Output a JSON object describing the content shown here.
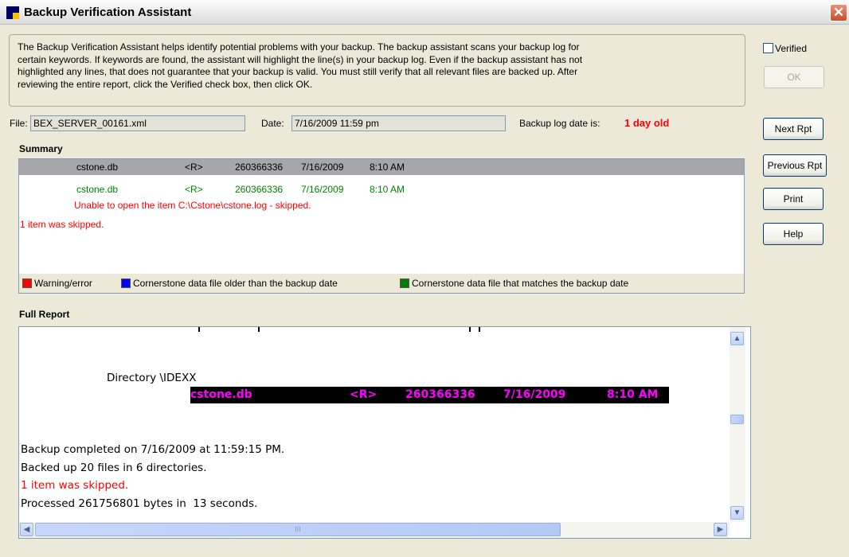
{
  "window": {
    "title": "Backup Verification Assistant",
    "close_glyph": "✕"
  },
  "intro_lines": [
    "The Backup Verification Assistant helps identify potential problems with your backup. The backup assistant scans your backup log for",
    "certain keywords. If keywords are found, the assistant will highlight the line(s) in your backup log. Even if the backup assistant has not",
    "highlighted any lines, that does not guarantee that your backup is valid. You must still verify that all relevant files are backed up. After",
    "reviewing the entire report, click the Verified check box, then click OK."
  ],
  "verified": {
    "label": "Verified",
    "checked": false
  },
  "buttons": {
    "ok": "OK",
    "next": "Next Rpt",
    "previous": "Previous Rpt",
    "print": "Print",
    "help": "Help"
  },
  "file": {
    "label": "File:",
    "value": "BEX_SERVER_00161.xml"
  },
  "date": {
    "label": "Date:",
    "value": "7/16/2009 11:59 pm"
  },
  "log_age": {
    "label": "Backup log date is:",
    "value": "1 day old"
  },
  "summary": {
    "heading": "Summary",
    "rows": [
      {
        "name": "cstone.db",
        "attr": "<R>",
        "size": "260366336",
        "date": "7/16/2009",
        "time": "8:10 AM"
      },
      {
        "name": "cstone.db",
        "attr": "<R>",
        "size": "260366336",
        "date": "7/16/2009",
        "time": "8:10 AM"
      }
    ],
    "error_line": "Unable to open the item C:\\Cstone\\cstone.log - skipped.",
    "skipped_line": "1 item was skipped."
  },
  "legend": {
    "warning": "Warning/error",
    "older": "Cornerstone data file older than the backup date",
    "matches": "Cornerstone data file that matches the backup date"
  },
  "colors": {
    "warning": "#ff0000",
    "older": "#0000ff",
    "matches": "#008000",
    "highlight_text": "#ff00ff"
  },
  "full_report": {
    "heading": "Full Report",
    "directory": "Directory \\IDEXX",
    "highlight": {
      "name": "cstone.db",
      "attr": "<R>",
      "size": "260366336",
      "date": "7/16/2009",
      "time": "8:10 AM"
    },
    "lines": [
      "Backup completed on 7/16/2009 at 11:59:15 PM.",
      "Backed up 20 files in 6 directories.",
      "1 item was skipped.",
      "Processed 261756801 bytes in  13 seconds."
    ],
    "scroll_thumb_grip": "III"
  }
}
